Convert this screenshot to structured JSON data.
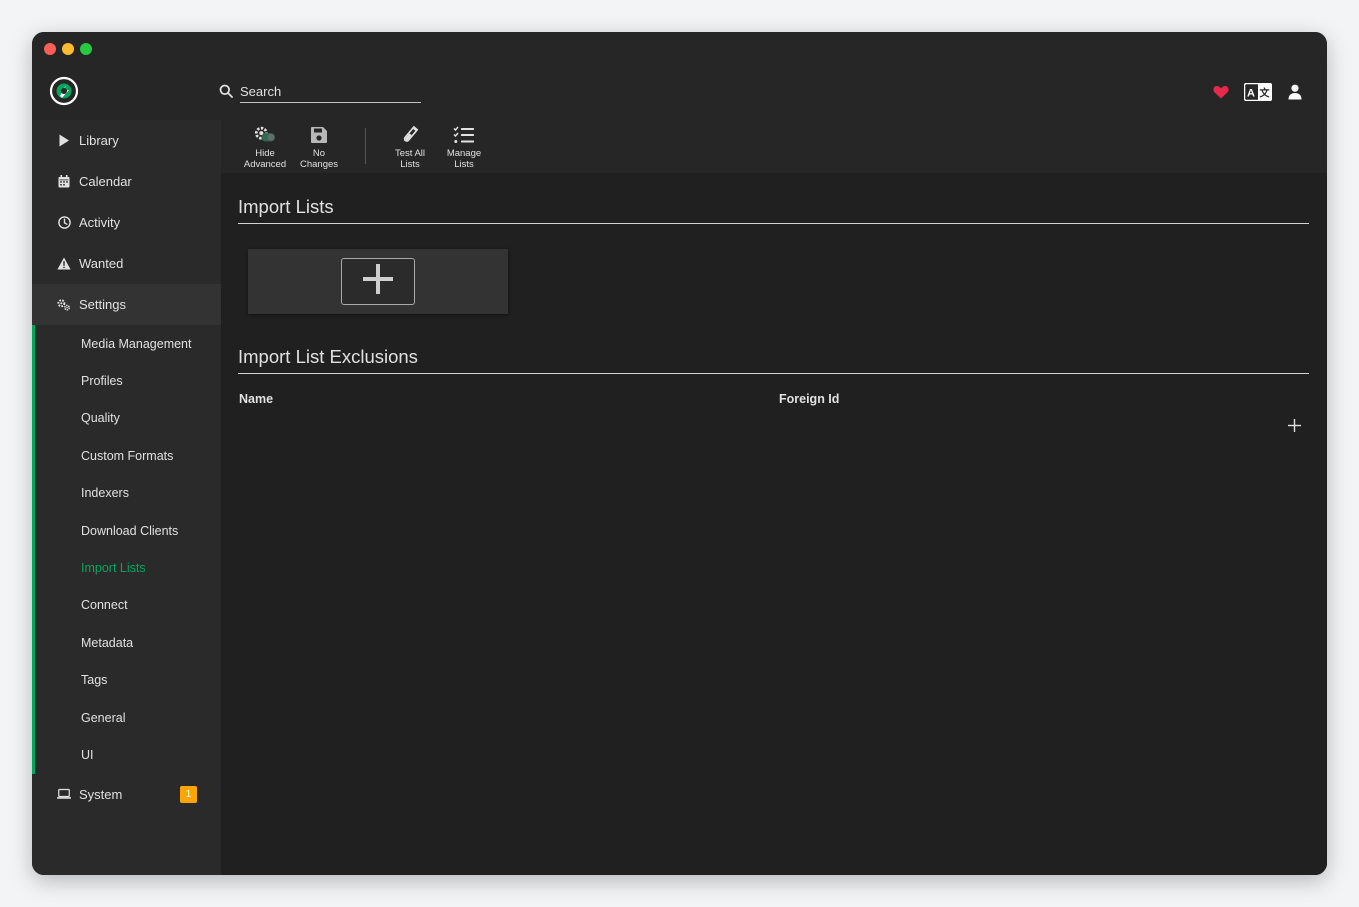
{
  "window": {
    "controls": [
      "close",
      "minimize",
      "zoom"
    ],
    "control_colors": {
      "close": "#ff5f57",
      "minimize": "#febc2e",
      "zoom": "#28c840"
    }
  },
  "header": {
    "logo_icon": "app-logo-icon",
    "search": {
      "placeholder": "Search",
      "value": "",
      "icon": "search-icon"
    },
    "right_icons": [
      "heart-icon",
      "translate-icon",
      "user-icon"
    ],
    "heart_color": "#e8294b"
  },
  "sidebar": {
    "accent_color": "#00a65b",
    "items": [
      {
        "label": "Library",
        "icon": "play-icon"
      },
      {
        "label": "Calendar",
        "icon": "calendar-icon"
      },
      {
        "label": "Activity",
        "icon": "clock-icon"
      },
      {
        "label": "Wanted",
        "icon": "warning-icon"
      },
      {
        "label": "Settings",
        "icon": "gears-icon"
      }
    ],
    "settings_sub": [
      {
        "label": "Media Management"
      },
      {
        "label": "Profiles"
      },
      {
        "label": "Quality"
      },
      {
        "label": "Custom Formats"
      },
      {
        "label": "Indexers"
      },
      {
        "label": "Download Clients"
      },
      {
        "label": "Import Lists",
        "active": true
      },
      {
        "label": "Connect"
      },
      {
        "label": "Metadata"
      },
      {
        "label": "Tags"
      },
      {
        "label": "General"
      },
      {
        "label": "UI"
      }
    ],
    "system": {
      "label": "System",
      "icon": "laptop-icon",
      "badge": "1",
      "badge_color": "#ffa500"
    }
  },
  "toolbar": {
    "buttons": [
      {
        "line1": "Hide",
        "line2": "Advanced",
        "icon": "gear-toggle-icon"
      },
      {
        "line1": "No",
        "line2": "Changes",
        "icon": "save-icon"
      },
      {
        "line1": "Test All",
        "line2": "Lists",
        "icon": "test-tube-icon"
      },
      {
        "line1": "Manage",
        "line2": "Lists",
        "icon": "list-check-icon"
      }
    ]
  },
  "main": {
    "import_lists_title": "Import Lists",
    "add_card_icon": "plus-icon",
    "exclusions_title": "Import List Exclusions",
    "table": {
      "columns": [
        "Name",
        "Foreign Id"
      ],
      "rows": [],
      "add_icon": "plus-icon"
    }
  }
}
